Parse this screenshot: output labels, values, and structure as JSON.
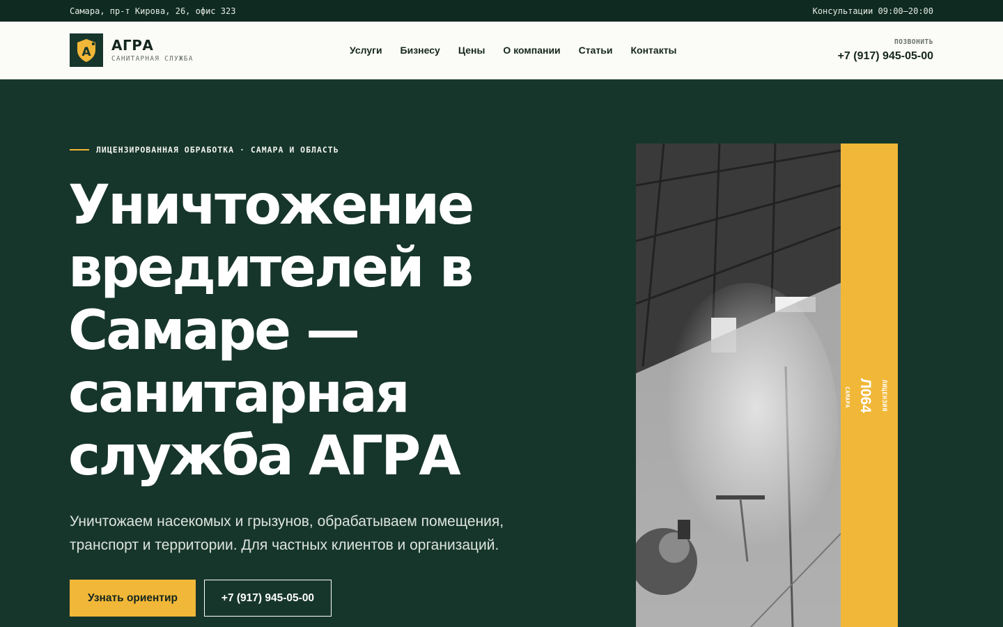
{
  "topbar": {
    "address": "Самара, пр-т Кирова, 26, офис 323",
    "hours": "Консультации 09:00–20:00"
  },
  "brand": {
    "logo_letter": "A",
    "name": "АГРА",
    "subtitle": "САНИТАРНАЯ СЛУЖБА",
    "icon": "shield-logo-icon"
  },
  "nav": {
    "items": [
      {
        "label": "Услуги"
      },
      {
        "label": "Бизнесу"
      },
      {
        "label": "Цены"
      },
      {
        "label": "О компании"
      },
      {
        "label": "Статьи"
      },
      {
        "label": "Контакты"
      }
    ]
  },
  "call": {
    "label": "ПОЗВОНИТЬ",
    "phone": "+7 (917) 945-05-00"
  },
  "hero": {
    "eyebrow": "ЛИЦЕНЗИРОВАННАЯ ОБРАБОТКА · САМАРА И ОБЛАСТЬ",
    "title_lines": [
      "Уничтожение",
      "вредителей в",
      "Самаре —",
      "санитарная",
      "служба АГРА"
    ],
    "lead_lines": [
      "Уничтожаем насекомых и грызунов, обрабатываем помещения,",
      "транспорт и территории. Для частных клиентов и организаций."
    ],
    "primary_button": "Узнать ориентир",
    "secondary_button": "+7 (917) 945-05-00"
  },
  "license": {
    "label": "ЛИЦЕНЗИЯ",
    "number": "Л064",
    "city": "САМАРА"
  },
  "colors": {
    "background": "#17362b",
    "topbar": "#0f2a20",
    "header": "#fbfbf7",
    "accent": "#f1b738",
    "text_dark": "#14261e"
  }
}
